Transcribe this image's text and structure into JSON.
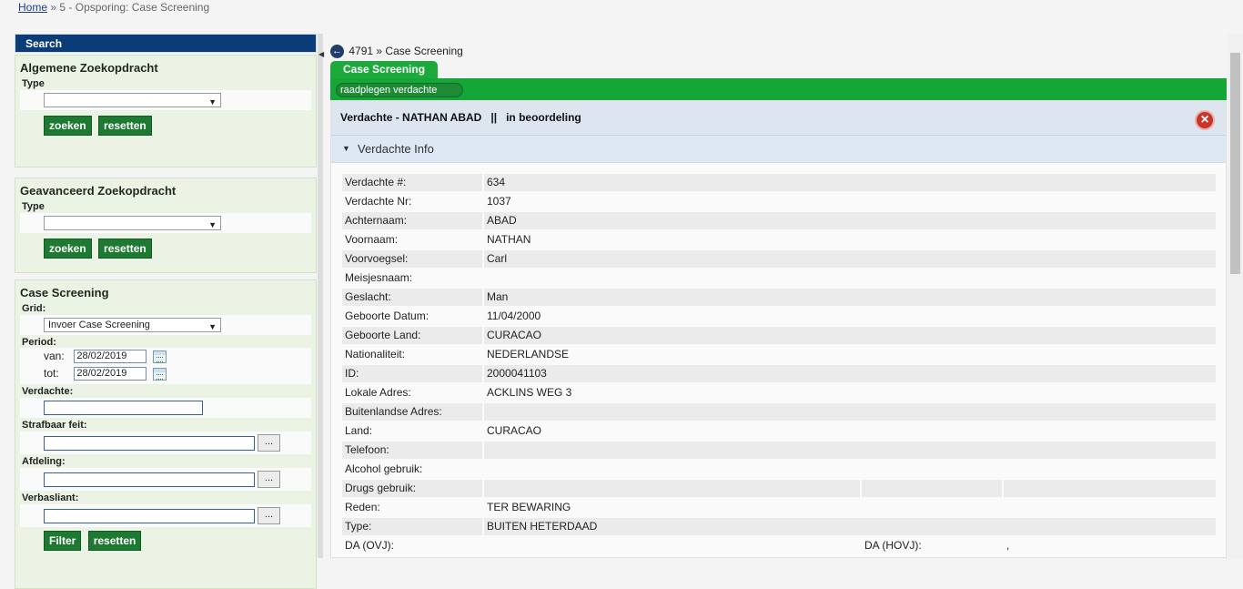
{
  "breadcrumb": {
    "home": "Home",
    "separator": "»",
    "current": "5 - Opsporing: Case Screening"
  },
  "sidebar": {
    "search_title": "Search",
    "general": {
      "title": "Algemene Zoekopdracht",
      "type_label": "Type",
      "type_value": "",
      "search_btn": "zoeken",
      "reset_btn": "resetten"
    },
    "advanced": {
      "title": "Geavanceerd Zoekopdracht",
      "type_label": "Type",
      "type_value": "",
      "search_btn": "zoeken",
      "reset_btn": "resetten"
    },
    "case": {
      "title": "Case Screening",
      "grid_label": "Grid:",
      "grid_value": "Invoer Case Screening",
      "period_label": "Period:",
      "van_label": "van:",
      "van_value": "28/02/2019",
      "tot_label": "tot:",
      "tot_value": "28/02/2019",
      "verdachte_label": "Verdachte:",
      "strafbaar_label": "Strafbaar feit:",
      "afdeling_label": "Afdeling:",
      "verbasliant_label": "Verbasliant:",
      "dots": "...",
      "filter_btn": "Filter",
      "reset_btn": "resetten"
    }
  },
  "topnav": {
    "id": "4791",
    "separator": "»",
    "title": "Case Screening"
  },
  "tab": {
    "label": "Case Screening"
  },
  "subtab": {
    "label": "raadplegen verdachte"
  },
  "header": {
    "title": "Verdachte - NATHAN ABAD   ||   in beoordeling"
  },
  "info_section": {
    "title": "Verdachte Info"
  },
  "fields": [
    {
      "label": "Verdachte #:",
      "value": "634"
    },
    {
      "label": "Verdachte Nr:",
      "value": "1037"
    },
    {
      "label": "Achternaam:",
      "value": "ABAD"
    },
    {
      "label": "Voornaam:",
      "value": "NATHAN"
    },
    {
      "label": "Voorvoegsel:",
      "value": "Carl"
    },
    {
      "label": "Meisjesnaam:",
      "value": ""
    },
    {
      "label": "Geslacht:",
      "value": "Man"
    },
    {
      "label": "Geboorte Datum:",
      "value": "11/04/2000"
    },
    {
      "label": "Geboorte Land:",
      "value": "CURACAO"
    },
    {
      "label": "Nationaliteit:",
      "value": "NEDERLANDSE"
    },
    {
      "label": "ID:",
      "value": "2000041103"
    },
    {
      "label": "Lokale Adres:",
      "value": "ACKLINS WEG 3"
    },
    {
      "label": "Buitenlandse Adres:",
      "value": ""
    },
    {
      "label": "Land:",
      "value": "CURACAO"
    },
    {
      "label": "Telefoon:",
      "value": ""
    },
    {
      "label": "Alcohol gebruik:",
      "value": ""
    },
    {
      "label": "Drugs gebruik:",
      "value": ""
    },
    {
      "label": "Reden:",
      "value": "TER BEWARING"
    },
    {
      "label": "Type:",
      "value": "BUITEN HETERDAAD"
    }
  ],
  "da_row": {
    "ovj_label": "DA (OVJ):",
    "hovj_label": "DA (HOVJ):",
    "hovj_value": ","
  },
  "colors": {
    "brand_blue": "#0a3d78",
    "green": "#14a636",
    "button_green": "#1e7a33",
    "close_red": "#c9352a"
  }
}
